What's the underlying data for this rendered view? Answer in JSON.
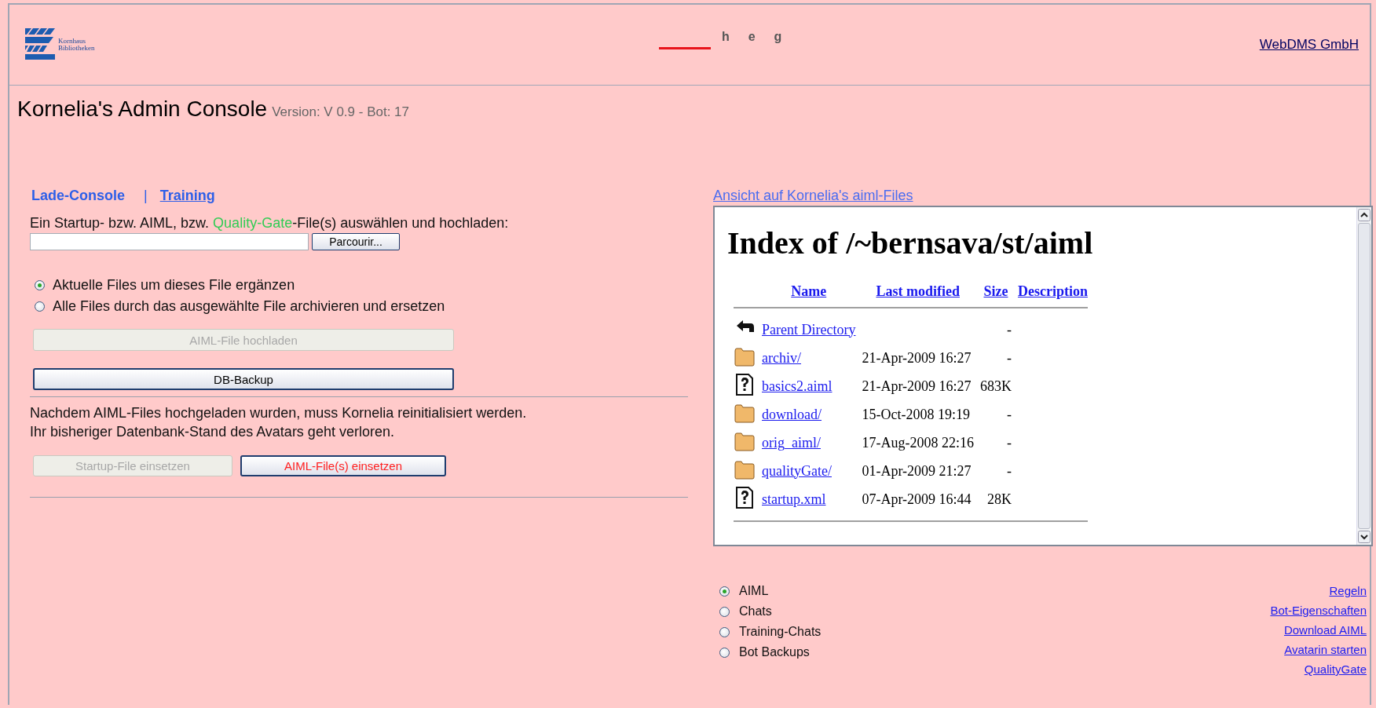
{
  "header": {
    "logo_lines": [
      "Kornhaus",
      "Bibliotheken"
    ],
    "nav_letters": [
      "h",
      "e",
      "g"
    ],
    "company_link": "WebDMS GmbH"
  },
  "title": {
    "name": "Kornelia's Admin Console",
    "version": "Version: V 0.9 - Bot: 17"
  },
  "console": {
    "tabs": [
      {
        "label": "Lade-Console",
        "selected": true
      },
      {
        "label": "Training",
        "selected": false
      }
    ],
    "separator": "|",
    "instruction": [
      {
        "text": "Ein Startup- bzw. AIML, bzw. ",
        "highlight": false
      },
      {
        "text": "Quality-Gate",
        "highlight": true
      },
      {
        "text": "-File(s) auswählen und hochladen:",
        "highlight": false
      }
    ],
    "browse_button": "Parcourir...",
    "upload_modes": [
      {
        "label": "Aktuelle Files um dieses File ergänzen",
        "selected": true
      },
      {
        "label": "Alle Files durch das ausgewählte File archivieren und ersetzen",
        "selected": false
      }
    ],
    "buttons": [
      {
        "label": "AIML-File hochladen",
        "disabled": true
      },
      {
        "label": "DB-Backup",
        "disabled": false
      }
    ],
    "notice": [
      "Nachdem AIML-Files hochgeladen wurden, muss Kornelia reinitialisiert werden.",
      "Ihr bisheriger Datenbank-Stand des Avatars geht verloren."
    ],
    "apply_buttons": [
      {
        "label": "Startup-File einsetzen",
        "disabled": true,
        "kind": "normal"
      },
      {
        "label": "AIML-File(s) einsetzen",
        "disabled": false,
        "kind": "warning"
      }
    ]
  },
  "files_view": {
    "link": "Ansicht auf Kornelia's aiml-Files",
    "heading": "Index of /~bernsava/st/aiml",
    "columns": [
      "Name",
      "Last modified",
      "Size",
      "Description"
    ],
    "rows": [
      {
        "kind": "parent",
        "name": "Parent Directory",
        "size": "-"
      },
      {
        "kind": "folder",
        "name": "archiv/",
        "modified": "21-Apr-2009 16:27",
        "size": "-"
      },
      {
        "kind": "file",
        "name": "basics2.aiml",
        "modified": "21-Apr-2009 16:27",
        "size": "683K"
      },
      {
        "kind": "folder",
        "name": "download/",
        "modified": "15-Oct-2008 19:19",
        "size": "-"
      },
      {
        "kind": "folder",
        "name": "orig_aiml/",
        "modified": "17-Aug-2008 22:16",
        "size": "-"
      },
      {
        "kind": "folder",
        "name": "qualityGate/",
        "modified": "01-Apr-2009 21:27",
        "size": "-"
      },
      {
        "kind": "file",
        "name": "startup.xml",
        "modified": "07-Apr-2009 16:44",
        "size": "28K"
      }
    ]
  },
  "view_options": [
    {
      "label": "AIML",
      "selected": true
    },
    {
      "label": "Chats",
      "selected": false
    },
    {
      "label": "Training-Chats",
      "selected": false
    },
    {
      "label": "Bot Backups",
      "selected": false
    }
  ],
  "links": [
    "Regeln",
    "Bot-Eigenschaften",
    "Download AIML",
    "Avatarin starten",
    "QualityGate"
  ]
}
